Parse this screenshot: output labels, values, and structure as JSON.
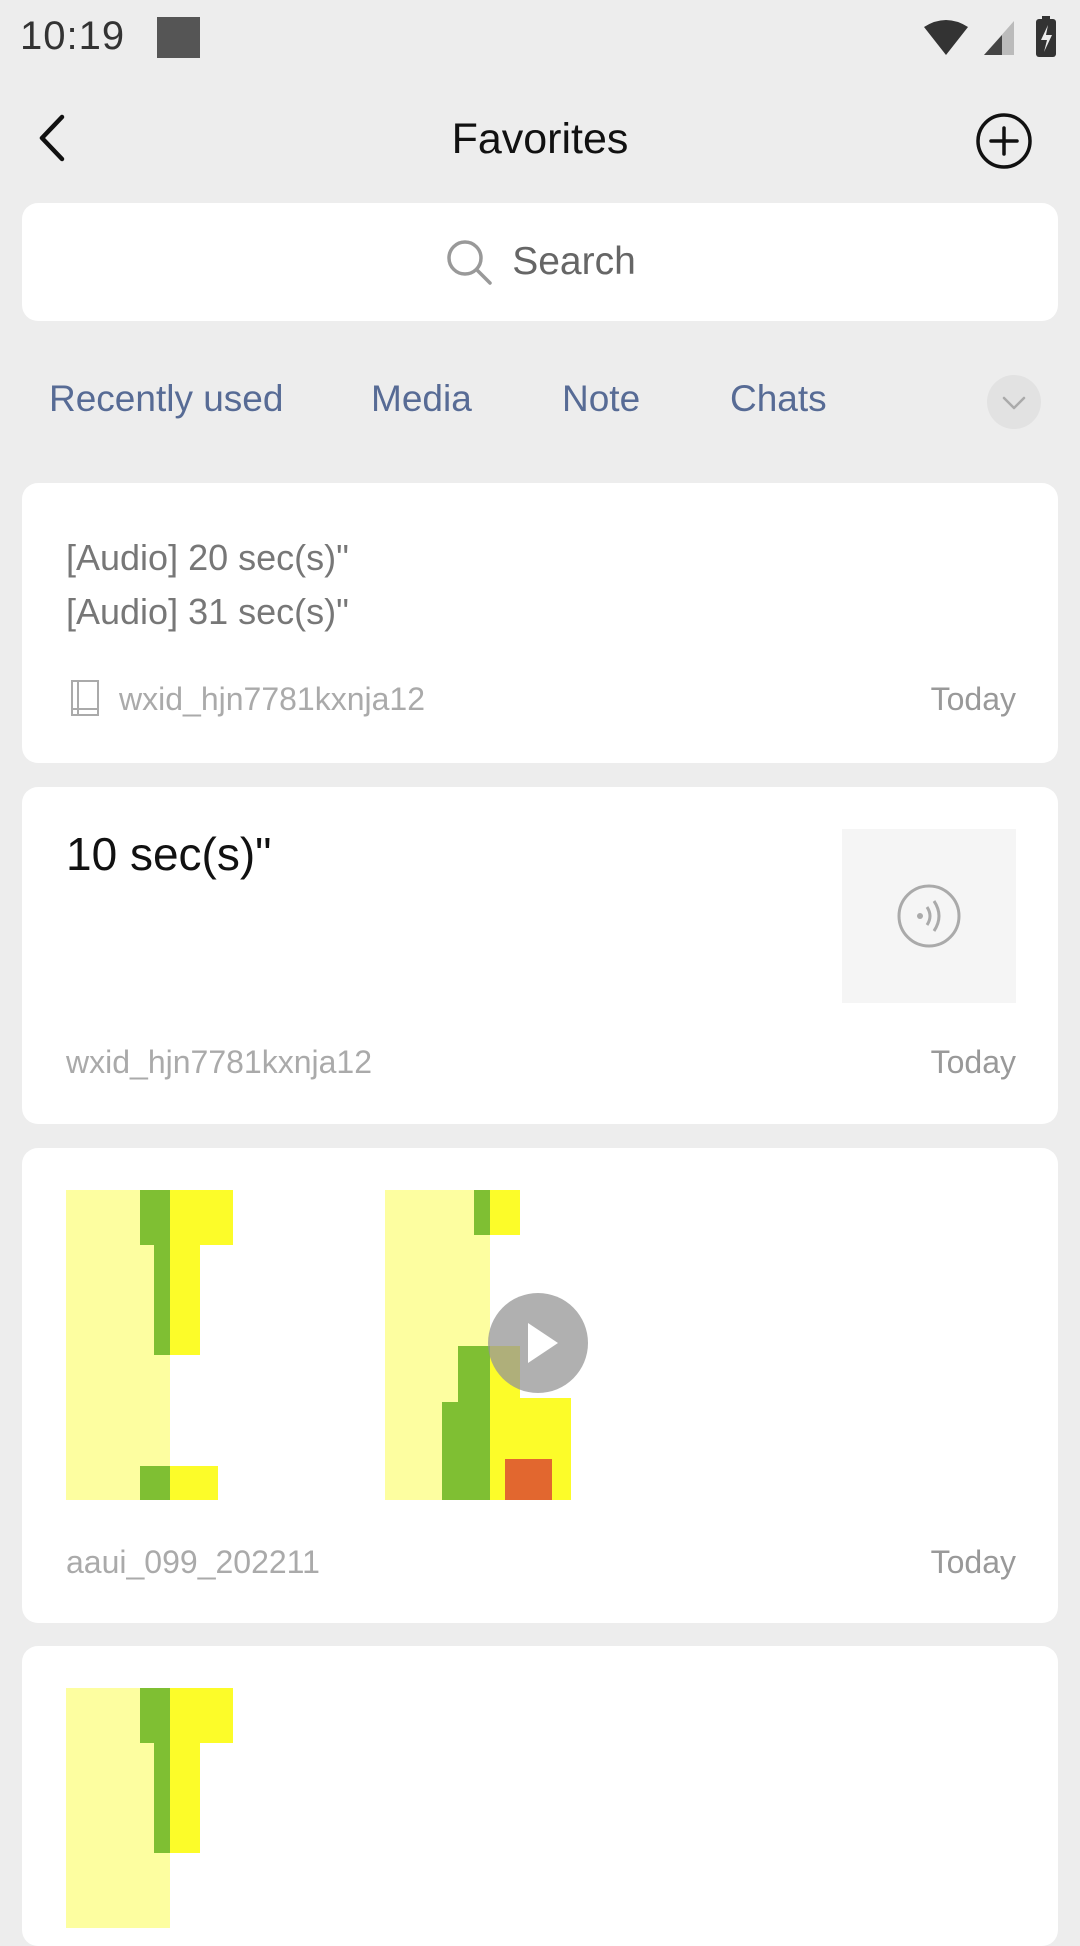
{
  "status_bar": {
    "time": "10:19"
  },
  "nav": {
    "title": "Favorites"
  },
  "search": {
    "placeholder": "Search"
  },
  "filters": [
    "Recently used",
    "Media",
    "Note",
    "Chats"
  ],
  "cards": [
    {
      "lines": [
        "[Audio] 20 sec(s)\"",
        "[Audio] 31 sec(s)\""
      ],
      "source": "wxid_hjn7781kxnja12",
      "time": "Today"
    },
    {
      "title": "10 sec(s)\"",
      "source": "wxid_hjn7781kxnja12",
      "time": "Today"
    },
    {
      "source": "aaui_099_202211",
      "time": "Today"
    },
    {}
  ],
  "colors": {
    "link_blue": "#576b95",
    "background": "#ededed",
    "thumb_pale_yellow": "#fdfea0",
    "thumb_yellow": "#fcfc29",
    "thumb_green": "#7fbf33",
    "thumb_orange": "#e2672f"
  }
}
